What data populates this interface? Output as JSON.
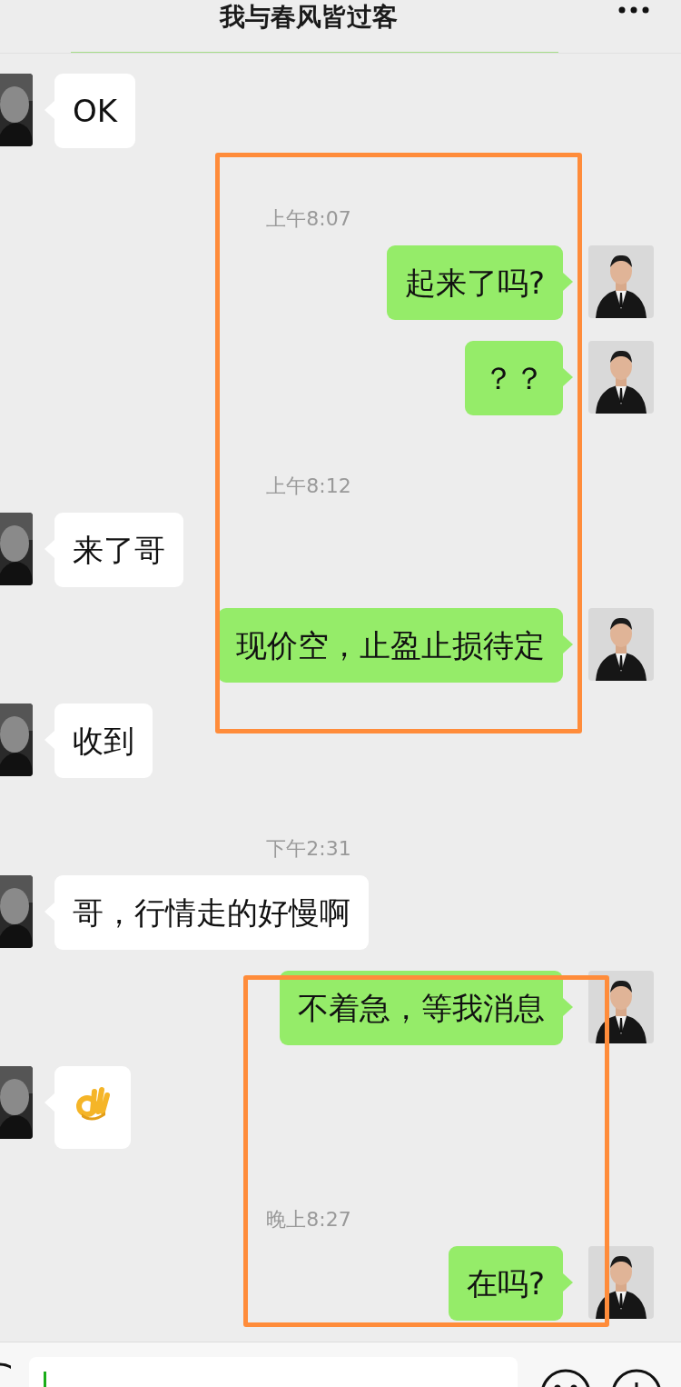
{
  "header": {
    "title": "我与春风皆过客"
  },
  "messages": [
    {
      "kind": "received",
      "text": "OK"
    },
    {
      "kind": "time",
      "text": "上午8:07"
    },
    {
      "kind": "sent",
      "text": "起来了吗?"
    },
    {
      "kind": "sent",
      "text": "？？"
    },
    {
      "kind": "time",
      "text": "上午8:12"
    },
    {
      "kind": "received",
      "text": "来了哥"
    },
    {
      "kind": "sent",
      "text": "现价空，止盈止损待定"
    },
    {
      "kind": "received",
      "text": "收到"
    },
    {
      "kind": "time",
      "text": "下午2:31"
    },
    {
      "kind": "received",
      "text": "哥，行情走的好慢啊"
    },
    {
      "kind": "sent",
      "text": "不着急，等我消息"
    },
    {
      "kind": "emoji"
    },
    {
      "kind": "time",
      "text": "晚上8:27"
    },
    {
      "kind": "sent",
      "text": "在吗?"
    }
  ]
}
